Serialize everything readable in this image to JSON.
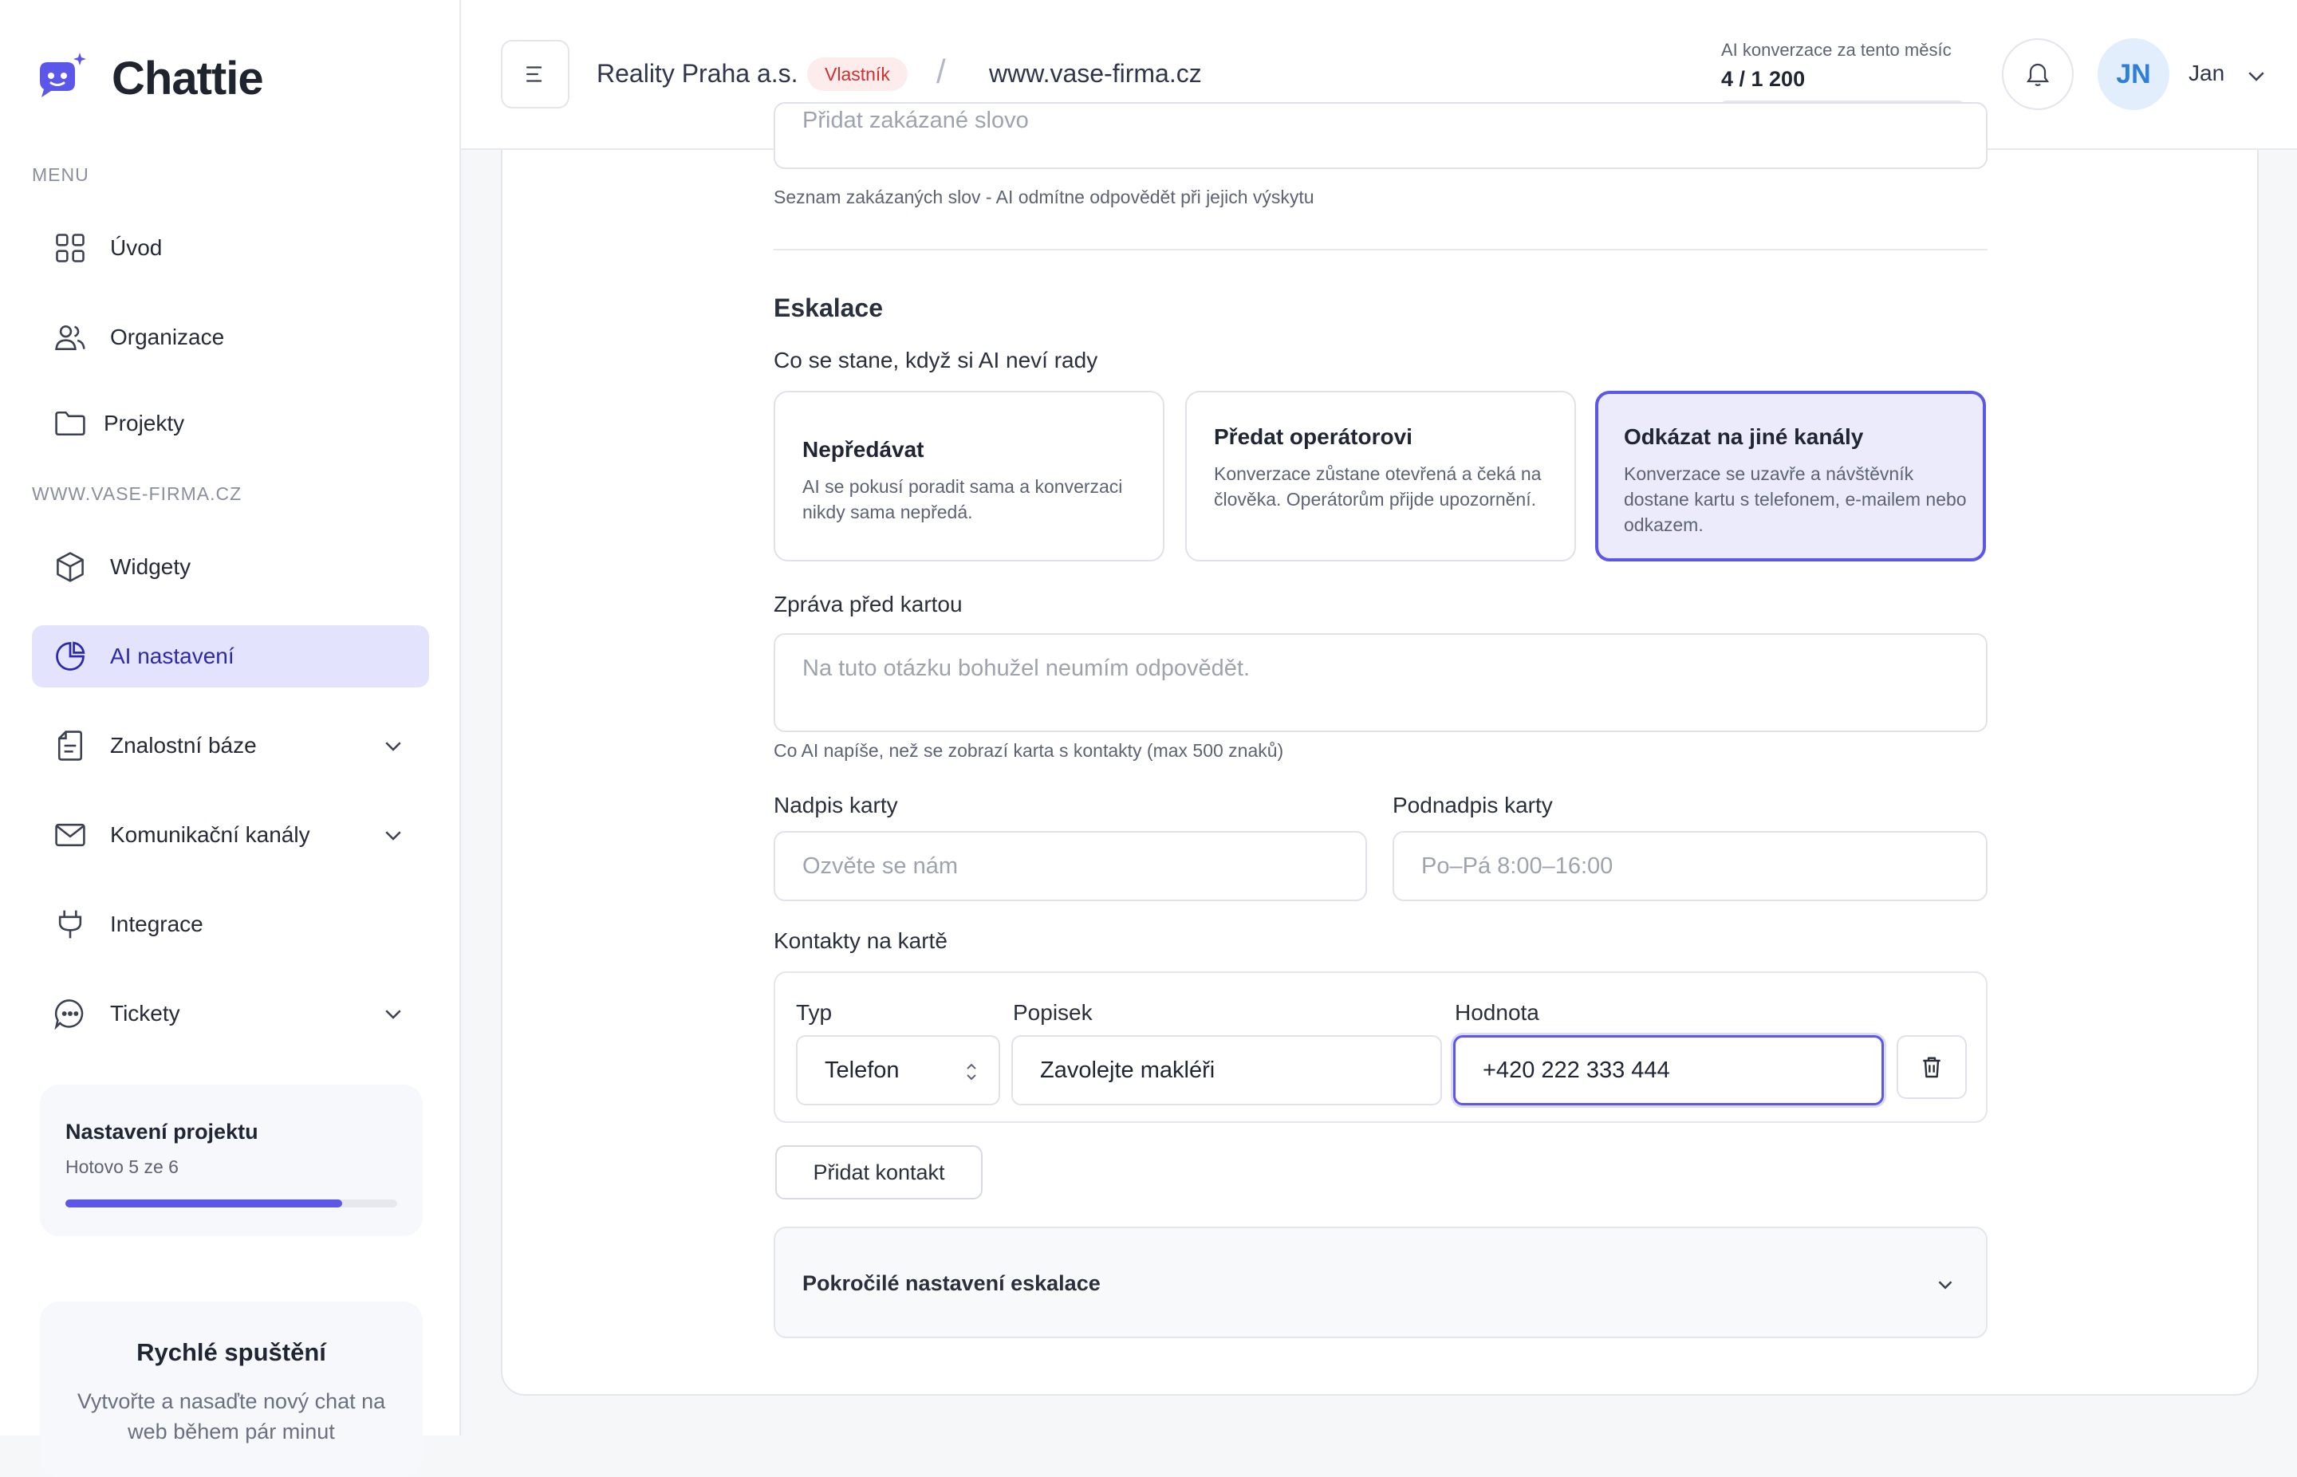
{
  "app": {
    "name": "Chattie"
  },
  "sidebar": {
    "menu_label": "MENU",
    "project_label": "WWW.VASE-FIRMA.CZ",
    "items": [
      {
        "label": "Úvod",
        "icon": "grid-icon"
      },
      {
        "label": "Organizace",
        "icon": "users-icon"
      },
      {
        "label": "Projekty",
        "icon": "folder-icon"
      },
      {
        "label": "Widgety",
        "icon": "cube-icon"
      },
      {
        "label": "AI nastavení",
        "icon": "pie-chart-icon",
        "active": true
      },
      {
        "label": "Znalostní báze",
        "icon": "document-icon",
        "expandable": true
      },
      {
        "label": "Komunikační kanály",
        "icon": "mail-icon",
        "expandable": true
      },
      {
        "label": "Integrace",
        "icon": "plug-icon"
      },
      {
        "label": "Tickety",
        "icon": "chat-bubble-icon",
        "expandable": true
      }
    ],
    "setup_card": {
      "title": "Nastavení projektu",
      "progress_text": "Hotovo 5 ze 6",
      "progress": 0.8333
    },
    "quick_card": {
      "title": "Rychlé spuštění",
      "text": "Vytvořte a nasaďte nový chat na web během pár minut"
    }
  },
  "header": {
    "org_name": "Reality Praha a.s.",
    "role_badge": "Vlastník",
    "separator": "/",
    "domain": "www.vase-firma.cz",
    "conversations_label": "AI konverzace za tento měsíc",
    "conversations_value": "4 / 1 200",
    "conversations_used": 4,
    "conversations_limit": 1200,
    "user_initials": "JN",
    "user_name": "Jan"
  },
  "forbidden_words": {
    "placeholder": "Přidat zakázané slovo",
    "hint": "Seznam zakázaných slov - AI odmítne odpovědět při jejich výskytu"
  },
  "escalation": {
    "title": "Eskalace",
    "question": "Co se stane, když si AI neví rady",
    "options": [
      {
        "title": "Nepředávat",
        "description": "AI se pokusí poradit sama a konverzaci nikdy sama nepředá.",
        "selected": false
      },
      {
        "title": "Předat operátorovi",
        "description": "Konverzace zůstane otevřená a čeká na člověka. Operátorům přijde upozornění.",
        "selected": false
      },
      {
        "title": "Odkázat na jiné kanály",
        "description": "Konverzace se uzavře a návštěvník dostane kartu s telefonem, e-mailem nebo odkazem.",
        "selected": true
      }
    ],
    "message_label": "Zpráva před kartou",
    "message_placeholder": "Na tuto otázku bohužel neumím odpovědět.",
    "message_hint": "Co AI napíše, než se zobrazí karta s kontakty (max 500 znaků)",
    "card_title_label": "Nadpis karty",
    "card_title_placeholder": "Ozvěte se nám",
    "card_subtitle_label": "Podnadpis karty",
    "card_subtitle_placeholder": "Po–Pá 8:00–16:00",
    "contacts_label": "Kontakty na kartě",
    "contacts_columns": {
      "type": "Typ",
      "label": "Popisek",
      "value": "Hodnota"
    },
    "contacts": [
      {
        "type": "Telefon",
        "label": "Zavolejte makléři",
        "value": "+420 222 333 444"
      }
    ],
    "add_contact_button": "Přidat kontakt",
    "advanced_label": "Pokročilé nastavení eskalace"
  },
  "colors": {
    "accent": "#5b57e8",
    "active_nav_bg": "#e3e3fd",
    "badge_bg": "#fdecec",
    "badge_text": "#d0302f",
    "avatar_bg": "#e2eefc",
    "avatar_text": "#2f7fd8"
  }
}
